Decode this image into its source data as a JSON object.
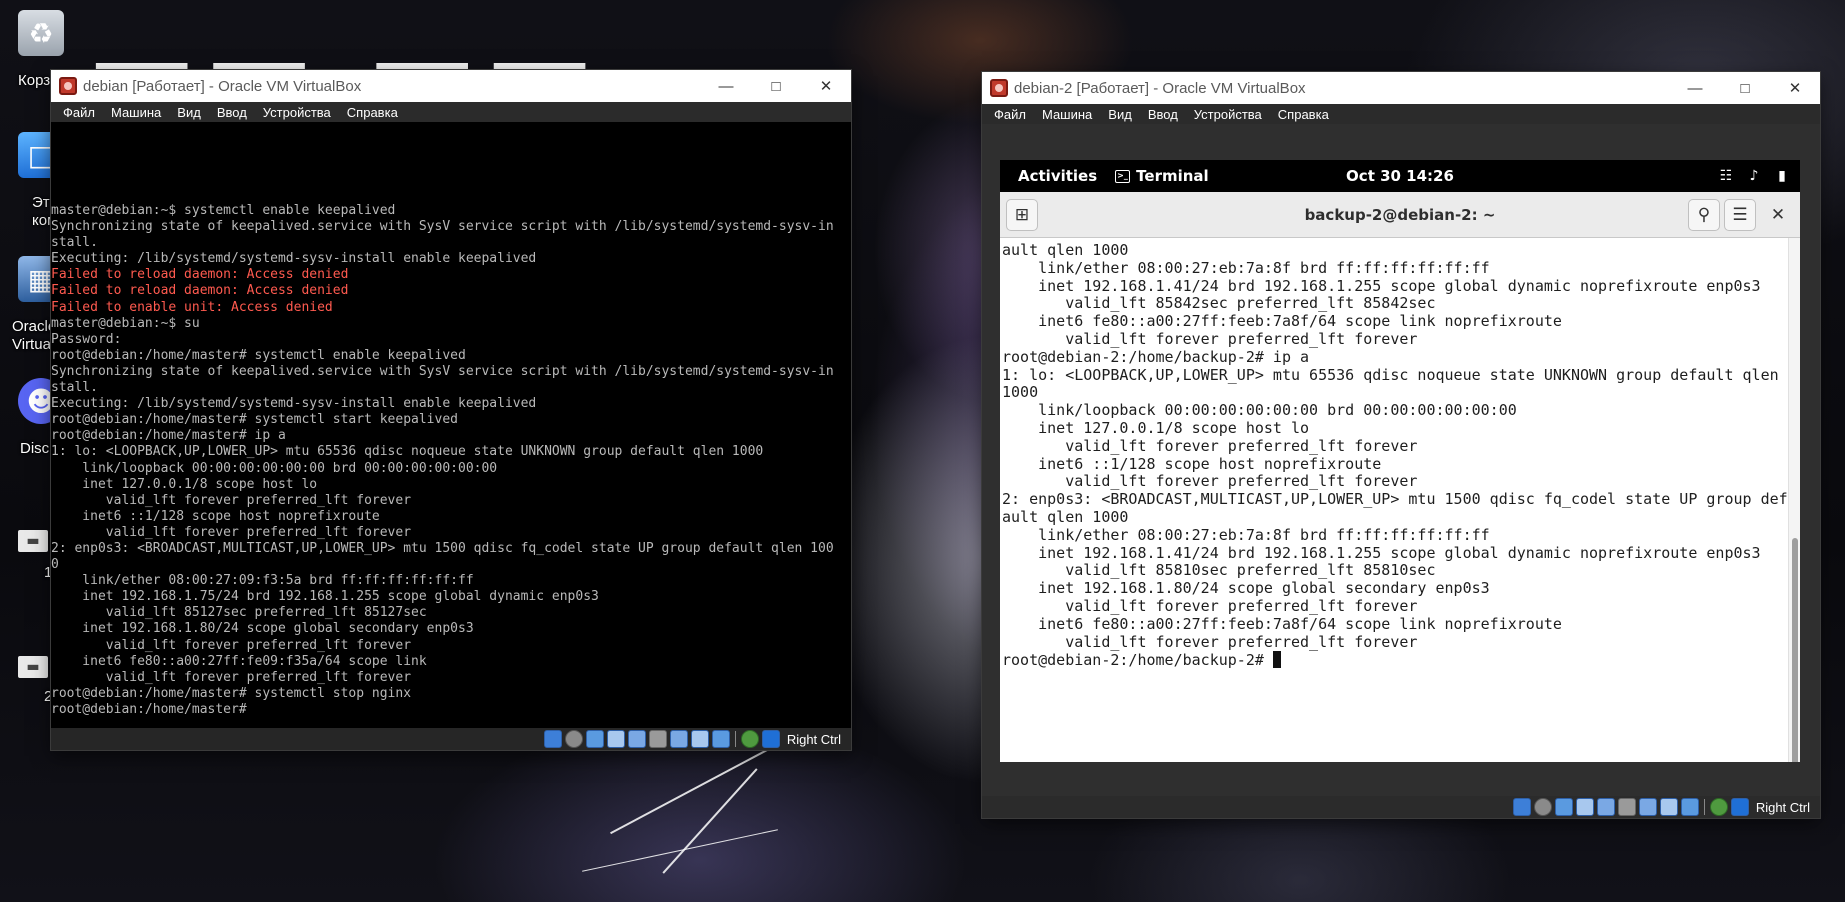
{
  "desktop": {
    "icons": [
      {
        "label": "Корз"
      },
      {
        "label": "Эт\nкомпь"
      },
      {
        "label": "Oracle\nVirtua"
      },
      {
        "label": "Disc"
      },
      {
        "label": "1"
      },
      {
        "label": "2"
      }
    ]
  },
  "vm1": {
    "title": "debian [Работает] - Oracle VM VirtualBox",
    "menu": [
      "Файл",
      "Машина",
      "Вид",
      "Ввод",
      "Устройства",
      "Справка"
    ],
    "host_key": "Right Ctrl",
    "console_lines": [
      {
        "text": "master@debian:~$ systemctl enable keepalived",
        "error": false
      },
      {
        "text": "Synchronizing state of keepalived.service with SysV service script with /lib/systemd/systemd-sysv-in",
        "error": false
      },
      {
        "text": "stall.",
        "error": false
      },
      {
        "text": "Executing: /lib/systemd/systemd-sysv-install enable keepalived",
        "error": false
      },
      {
        "text": "Failed to reload daemon: Access denied",
        "error": true
      },
      {
        "text": "Failed to reload daemon: Access denied",
        "error": true
      },
      {
        "text": "Failed to enable unit: Access denied",
        "error": true
      },
      {
        "text": "master@debian:~$ su",
        "error": false
      },
      {
        "text": "Password:",
        "error": false
      },
      {
        "text": "root@debian:/home/master# systemctl enable keepalived",
        "error": false
      },
      {
        "text": "Synchronizing state of keepalived.service with SysV service script with /lib/systemd/systemd-sysv-in",
        "error": false
      },
      {
        "text": "stall.",
        "error": false
      },
      {
        "text": "Executing: /lib/systemd/systemd-sysv-install enable keepalived",
        "error": false
      },
      {
        "text": "root@debian:/home/master# systemctl start keepalived",
        "error": false
      },
      {
        "text": "root@debian:/home/master# ip a",
        "error": false
      },
      {
        "text": "1: lo: <LOOPBACK,UP,LOWER_UP> mtu 65536 qdisc noqueue state UNKNOWN group default qlen 1000",
        "error": false
      },
      {
        "text": "    link/loopback 00:00:00:00:00:00 brd 00:00:00:00:00:00",
        "error": false
      },
      {
        "text": "    inet 127.0.0.1/8 scope host lo",
        "error": false
      },
      {
        "text": "       valid_lft forever preferred_lft forever",
        "error": false
      },
      {
        "text": "    inet6 ::1/128 scope host noprefixroute",
        "error": false
      },
      {
        "text": "       valid_lft forever preferred_lft forever",
        "error": false
      },
      {
        "text": "2: enp0s3: <BROADCAST,MULTICAST,UP,LOWER_UP> mtu 1500 qdisc fq_codel state UP group default qlen 100",
        "error": false
      },
      {
        "text": "0",
        "error": false
      },
      {
        "text": "    link/ether 08:00:27:09:f3:5a brd ff:ff:ff:ff:ff:ff",
        "error": false
      },
      {
        "text": "    inet 192.168.1.75/24 brd 192.168.1.255 scope global dynamic enp0s3",
        "error": false
      },
      {
        "text": "       valid_lft 85127sec preferred_lft 85127sec",
        "error": false
      },
      {
        "text": "    inet 192.168.1.80/24 scope global secondary enp0s3",
        "error": false
      },
      {
        "text": "       valid_lft forever preferred_lft forever",
        "error": false
      },
      {
        "text": "    inet6 fe80::a00:27ff:fe09:f35a/64 scope link",
        "error": false
      },
      {
        "text": "       valid_lft forever preferred_lft forever",
        "error": false
      },
      {
        "text": "root@debian:/home/master# systemctl stop nginx",
        "error": false
      },
      {
        "text": "root@debian:/home/master#",
        "error": false
      }
    ]
  },
  "vm2": {
    "title": "debian-2 [Работает] - Oracle VM VirtualBox",
    "menu": [
      "Файл",
      "Машина",
      "Вид",
      "Ввод",
      "Устройства",
      "Справка"
    ],
    "host_key": "Right Ctrl",
    "gnome": {
      "activities": "Activities",
      "app_name": "Terminal",
      "clock": "Oct 30  14:26"
    },
    "terminal": {
      "title": "backup-2@debian-2: ~",
      "lines": [
        "ault qlen 1000",
        "    link/ether 08:00:27:eb:7a:8f brd ff:ff:ff:ff:ff:ff",
        "    inet 192.168.1.41/24 brd 192.168.1.255 scope global dynamic noprefixroute enp0s3",
        "       valid_lft 85842sec preferred_lft 85842sec",
        "    inet6 fe80::a00:27ff:feeb:7a8f/64 scope link noprefixroute",
        "       valid_lft forever preferred_lft forever",
        "root@debian-2:/home/backup-2# ip a",
        "1: lo: <LOOPBACK,UP,LOWER_UP> mtu 65536 qdisc noqueue state UNKNOWN group default qlen",
        "1000",
        "    link/loopback 00:00:00:00:00:00 brd 00:00:00:00:00:00",
        "    inet 127.0.0.1/8 scope host lo",
        "       valid_lft forever preferred_lft forever",
        "    inet6 ::1/128 scope host noprefixroute",
        "       valid_lft forever preferred_lft forever",
        "2: enp0s3: <BROADCAST,MULTICAST,UP,LOWER_UP> mtu 1500 qdisc fq_codel state UP group def",
        "ault qlen 1000",
        "    link/ether 08:00:27:eb:7a:8f brd ff:ff:ff:ff:ff:ff",
        "    inet 192.168.1.41/24 brd 192.168.1.255 scope global dynamic noprefixroute enp0s3",
        "       valid_lft 85810sec preferred_lft 85810sec",
        "    inet 192.168.1.80/24 scope global secondary enp0s3",
        "       valid_lft forever preferred_lft forever",
        "    inet6 fe80::a00:27ff:feeb:7a8f/64 scope link noprefixroute",
        "       valid_lft forever preferred_lft forever"
      ],
      "prompt": "root@debian-2:/home/backup-2# "
    }
  },
  "colors": {
    "console_text": "#b9b9b9",
    "console_error": "#ff5a4f",
    "menubar_bg": "#2b2b2b"
  }
}
